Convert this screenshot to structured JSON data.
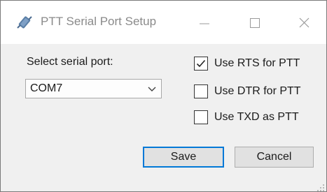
{
  "window": {
    "title": "PTT Serial Port Setup",
    "icons": {
      "app": "serial-plug-icon",
      "minimize": "minimize-icon",
      "maximize": "maximize-icon",
      "close": "close-icon"
    }
  },
  "port": {
    "label": "Select serial port:",
    "selected": "COM7",
    "dropdown_icon": "chevron-down-icon"
  },
  "options": [
    {
      "label": "Use RTS for PTT",
      "checked": true
    },
    {
      "label": "Use DTR for PTT",
      "checked": false
    },
    {
      "label": "Use TXD as PTT",
      "checked": false
    }
  ],
  "buttons": {
    "save": "Save",
    "cancel": "Cancel"
  },
  "colors": {
    "focus_border": "#0078d7",
    "title_text": "#8a8a8a",
    "titlebar_bg": "#ffffff",
    "dialog_bg": "#f0f0f0"
  }
}
